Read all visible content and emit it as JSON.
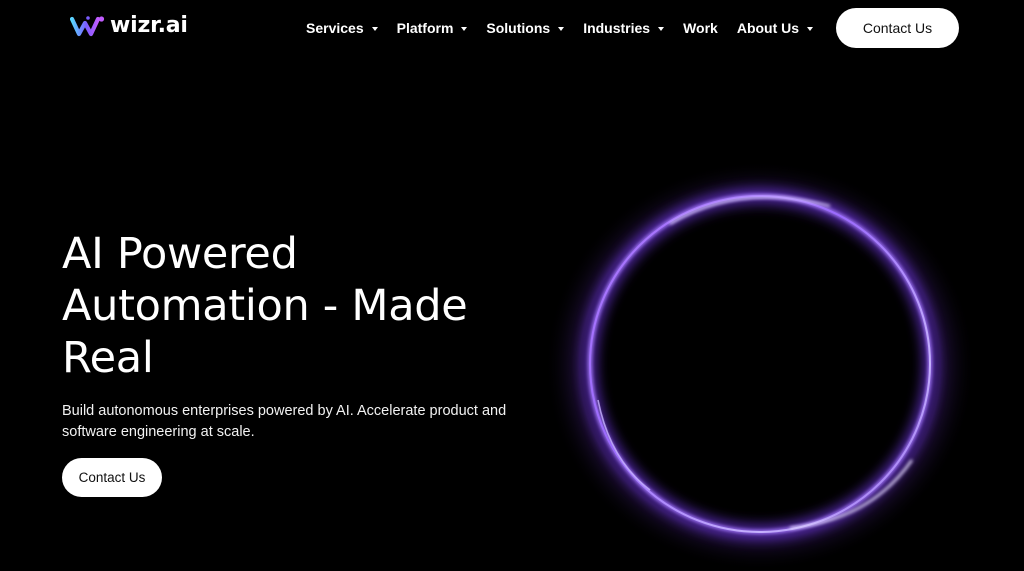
{
  "brand": {
    "name": "wizr.ai",
    "logo_icon": "wizr-logo-mark",
    "logo_colors": [
      "#5ad6ff",
      "#7b5cff",
      "#c15cff"
    ]
  },
  "nav": {
    "items": [
      {
        "label": "Services",
        "has_dropdown": true
      },
      {
        "label": "Platform",
        "has_dropdown": true
      },
      {
        "label": "Solutions",
        "has_dropdown": true
      },
      {
        "label": "Industries",
        "has_dropdown": true
      },
      {
        "label": "Work",
        "has_dropdown": false
      },
      {
        "label": "About Us",
        "has_dropdown": true
      }
    ],
    "cta_label": "Contact Us"
  },
  "hero": {
    "title_lines": [
      "AI Powered",
      "Automation - Made",
      "Real"
    ],
    "subtitle_lines": [
      "Build autonomous enterprises powered by AI. Accelerate product and",
      "software engineering at scale."
    ],
    "cta_label": "Contact Us"
  },
  "colors": {
    "background": "#000000",
    "ring_primary": "#9b6bff",
    "ring_highlight": "#d7c8ff",
    "button_bg": "#ffffff",
    "button_text": "#111111"
  }
}
